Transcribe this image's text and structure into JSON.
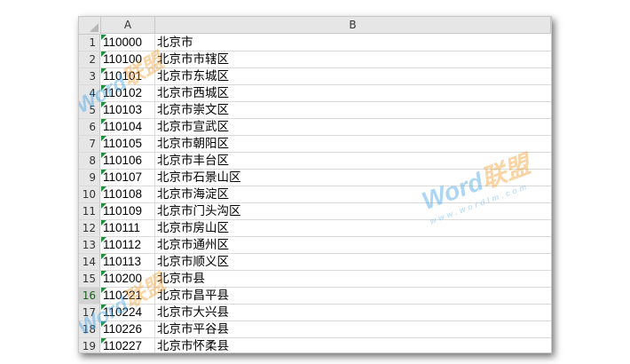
{
  "sheet": {
    "columns": [
      "A",
      "B"
    ],
    "rows": [
      {
        "num": "1",
        "a": "110000",
        "b": "北京市"
      },
      {
        "num": "2",
        "a": "110100",
        "b": "北京市市辖区"
      },
      {
        "num": "3",
        "a": "110101",
        "b": "北京市东城区"
      },
      {
        "num": "4",
        "a": "110102",
        "b": "北京市西城区"
      },
      {
        "num": "5",
        "a": "110103",
        "b": "北京市崇文区"
      },
      {
        "num": "6",
        "a": "110104",
        "b": "北京市宣武区"
      },
      {
        "num": "7",
        "a": "110105",
        "b": "北京市朝阳区"
      },
      {
        "num": "8",
        "a": "110106",
        "b": "北京市丰台区"
      },
      {
        "num": "9",
        "a": "110107",
        "b": "北京市石景山区"
      },
      {
        "num": "10",
        "a": "110108",
        "b": "北京市海淀区"
      },
      {
        "num": "11",
        "a": "110109",
        "b": "北京市门头沟区"
      },
      {
        "num": "12",
        "a": "110111",
        "b": "北京市房山区"
      },
      {
        "num": "13",
        "a": "110112",
        "b": "北京市通州区"
      },
      {
        "num": "14",
        "a": "110113",
        "b": "北京市顺义区"
      },
      {
        "num": "15",
        "a": "110200",
        "b": "北京市县"
      },
      {
        "num": "16",
        "a": "110221",
        "b": "北京市昌平县"
      },
      {
        "num": "17",
        "a": "110224",
        "b": "北京市大兴县"
      },
      {
        "num": "18",
        "a": "110226",
        "b": "北京市平谷县"
      },
      {
        "num": "19",
        "a": "110227",
        "b": "北京市怀柔县"
      }
    ],
    "selected_row": "16"
  },
  "watermark": {
    "word": "Word",
    "brand": "联盟",
    "url": "www.wordlm.com"
  },
  "colors": {
    "header_bg": "#e6e6e6",
    "gridline": "#dadada",
    "error_flag": "#1e8f3a",
    "watermark_blue": "#3aa0e6",
    "watermark_orange": "#f39a2a"
  }
}
